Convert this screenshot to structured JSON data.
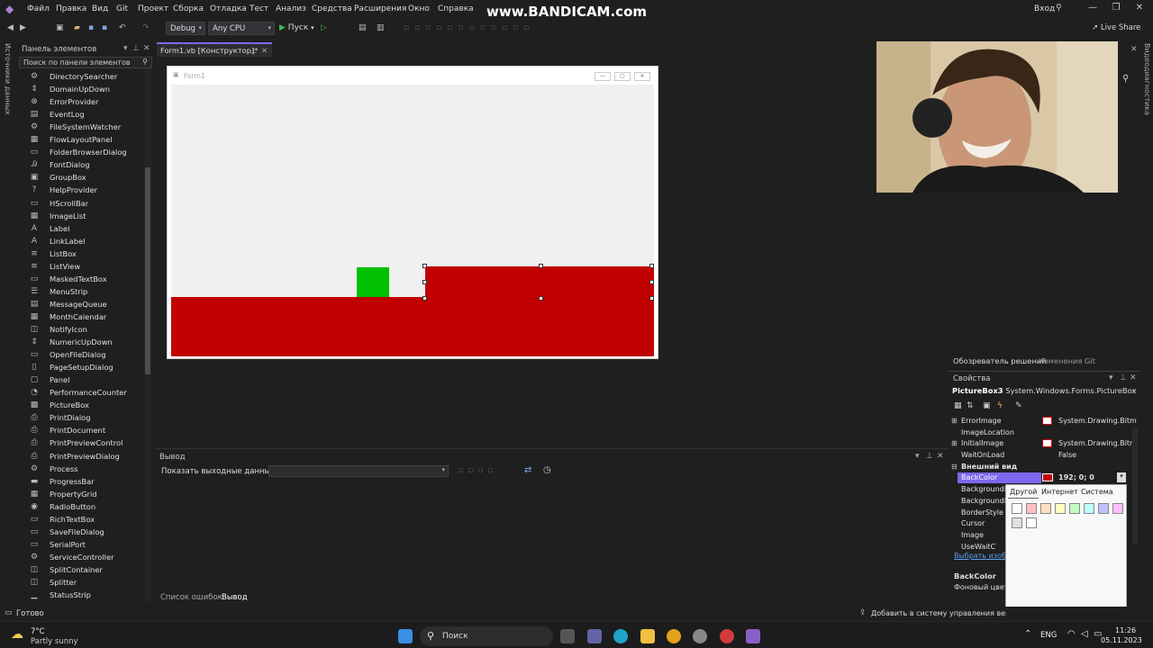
{
  "menubar": {
    "items": [
      "Файл",
      "Правка",
      "Вид",
      "Git",
      "Проект",
      "Сборка",
      "Отладка",
      "Тест",
      "Анализ",
      "Средства",
      "Расширения",
      "Окно",
      "Справка"
    ],
    "watermark": "www.BANDICAM.com",
    "login": "Вход",
    "live_share": "Live Share"
  },
  "toolbar": {
    "config": "Debug",
    "platform": "Any CPU",
    "run_label": "Пуск"
  },
  "left_strip": {
    "label": "Источники данных"
  },
  "right_strip": {
    "label": "Видеодиагностика"
  },
  "toolbox": {
    "title": "Панель элементов",
    "search_placeholder": "Поиск по панели элементов",
    "items": [
      {
        "label": "DirectorySearcher",
        "icon": "gear"
      },
      {
        "label": "DomainUpDown",
        "icon": "updown"
      },
      {
        "label": "ErrorProvider",
        "icon": "error"
      },
      {
        "label": "EventLog",
        "icon": "log"
      },
      {
        "label": "FileSystemWatcher",
        "icon": "gear"
      },
      {
        "label": "FlowLayoutPanel",
        "icon": "layout"
      },
      {
        "label": "FolderBrowserDialog",
        "icon": "folder"
      },
      {
        "label": "FontDialog",
        "icon": "font"
      },
      {
        "label": "GroupBox",
        "icon": "group"
      },
      {
        "label": "HelpProvider",
        "icon": "help"
      },
      {
        "label": "HScrollBar",
        "icon": "scroll"
      },
      {
        "label": "ImageList",
        "icon": "image"
      },
      {
        "label": "Label",
        "icon": "label"
      },
      {
        "label": "LinkLabel",
        "icon": "label"
      },
      {
        "label": "ListBox",
        "icon": "list"
      },
      {
        "label": "ListView",
        "icon": "list"
      },
      {
        "label": "MaskedTextBox",
        "icon": "textbox"
      },
      {
        "label": "MenuStrip",
        "icon": "menu"
      },
      {
        "label": "MessageQueue",
        "icon": "queue"
      },
      {
        "label": "MonthCalendar",
        "icon": "calendar"
      },
      {
        "label": "NotifyIcon",
        "icon": "notify"
      },
      {
        "label": "NumericUpDown",
        "icon": "updown"
      },
      {
        "label": "OpenFileDialog",
        "icon": "file"
      },
      {
        "label": "PageSetupDialog",
        "icon": "page"
      },
      {
        "label": "Panel",
        "icon": "panel"
      },
      {
        "label": "PerformanceCounter",
        "icon": "counter"
      },
      {
        "label": "PictureBox",
        "icon": "picture"
      },
      {
        "label": "PrintDialog",
        "icon": "print"
      },
      {
        "label": "PrintDocument",
        "icon": "print"
      },
      {
        "label": "PrintPreviewControl",
        "icon": "print"
      },
      {
        "label": "PrintPreviewDialog",
        "icon": "print"
      },
      {
        "label": "Process",
        "icon": "gear"
      },
      {
        "label": "ProgressBar",
        "icon": "progress"
      },
      {
        "label": "PropertyGrid",
        "icon": "grid"
      },
      {
        "label": "RadioButton",
        "icon": "radio"
      },
      {
        "label": "RichTextBox",
        "icon": "textbox"
      },
      {
        "label": "SaveFileDialog",
        "icon": "file"
      },
      {
        "label": "SerialPort",
        "icon": "port"
      },
      {
        "label": "ServiceController",
        "icon": "gear"
      },
      {
        "label": "SplitContainer",
        "icon": "split"
      },
      {
        "label": "Splitter",
        "icon": "split"
      },
      {
        "label": "StatusStrip",
        "icon": "status"
      }
    ]
  },
  "document": {
    "tab_label": "Form1.vb [Конструктор]*",
    "form_title": "Form1",
    "colors": {
      "ground": "#c00000",
      "player": "#00c000",
      "form_bg": "#f0f0f0"
    }
  },
  "output": {
    "title": "Вывод",
    "show_from_label": "Показать выходные данные из:"
  },
  "bottom_tabs": [
    "Список ошибок",
    "Вывод"
  ],
  "solution_tabs": [
    "Обозреватель решений",
    "Изменения Git"
  ],
  "properties": {
    "title": "Свойства",
    "object": "PictureBox3",
    "object_type": "System.Windows.Forms.PictureBox",
    "rows": [
      {
        "name": "ErrorImage",
        "value": "System.Drawing.Bitm",
        "expand": "⊞"
      },
      {
        "name": "ImageLocation",
        "value": "",
        "expand": ""
      },
      {
        "name": "InitialImage",
        "value": "System.Drawing.Bitm",
        "expand": "⊞"
      },
      {
        "name": "WaitOnLoad",
        "value": "False",
        "expand": ""
      }
    ],
    "category": "Внешний вид",
    "backcolor_name": "BackColor",
    "backcolor_value": "192; 0; 0",
    "backcolor_swatch": "#c00000",
    "more_rows": [
      "BackgroundI",
      "BackgroundI",
      "BorderStyle",
      "Cursor",
      "Image",
      "UseWaitC"
    ],
    "select_image_link": "Выбрать изобр",
    "desc_title": "BackColor",
    "desc_text": "Фоновый цвет к"
  },
  "color_popup": {
    "tabs": [
      "Другой",
      "Интернет",
      "Система"
    ],
    "swatches": [
      "#ffffff",
      "#ffc0c0",
      "#ffe0c0",
      "#ffffc0",
      "#c0ffc0",
      "#c0ffff",
      "#c0c0ff",
      "#ffc0ff",
      "#e0e0e0",
      "#ffffff"
    ]
  },
  "statusbar": {
    "ready": "Готово",
    "source_control": "Добавить в систему управления версиями"
  },
  "taskbar": {
    "weather_temp": "7°C",
    "weather_desc": "Partly sunny",
    "search_label": "Поиск",
    "lang": "ENG",
    "time": "11:26",
    "date": "05.11.2023"
  }
}
